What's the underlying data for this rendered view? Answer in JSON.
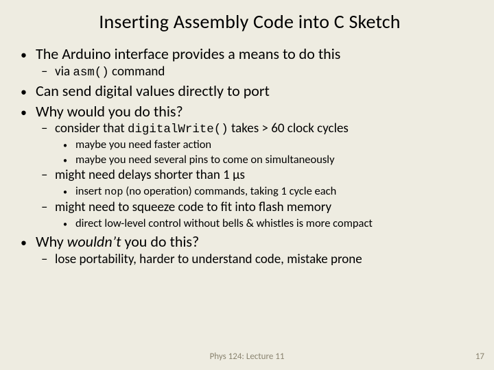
{
  "title": "Inserting Assembly Code into C Sketch",
  "b1": {
    "text": "The Arduino interface provides a means to do this"
  },
  "b1s1": {
    "pre": "via ",
    "code": "asm()",
    "post": " command"
  },
  "b2": {
    "text": "Can send digital values directly to port"
  },
  "b3": {
    "text": "Why would you do this?"
  },
  "b3s1": {
    "pre": "consider that ",
    "code": "digitalWrite()",
    "post": " takes > 60 clock cycles"
  },
  "b3s1a": {
    "text": "maybe you need faster action"
  },
  "b3s1b": {
    "text": "maybe you need several pins to come on simultaneously"
  },
  "b3s2": {
    "pre": "might need delays shorter than 1 ",
    "sym": "μ",
    "post": "s"
  },
  "b3s2a": {
    "pre": "insert ",
    "code": "nop",
    "post": " (no operation) commands, taking 1 cycle each"
  },
  "b3s3": {
    "text": "might need to squeeze code to fit into flash memory"
  },
  "b3s3a": {
    "text": "direct low-level control without bells & whistles is more compact"
  },
  "b4": {
    "pre": "Why ",
    "em": "wouldn’t",
    "post": " you do this?"
  },
  "b4s1": {
    "text": "lose portability, harder to understand code, mistake prone"
  },
  "footer": {
    "center": "Phys 124: Lecture 11",
    "page": "17"
  }
}
